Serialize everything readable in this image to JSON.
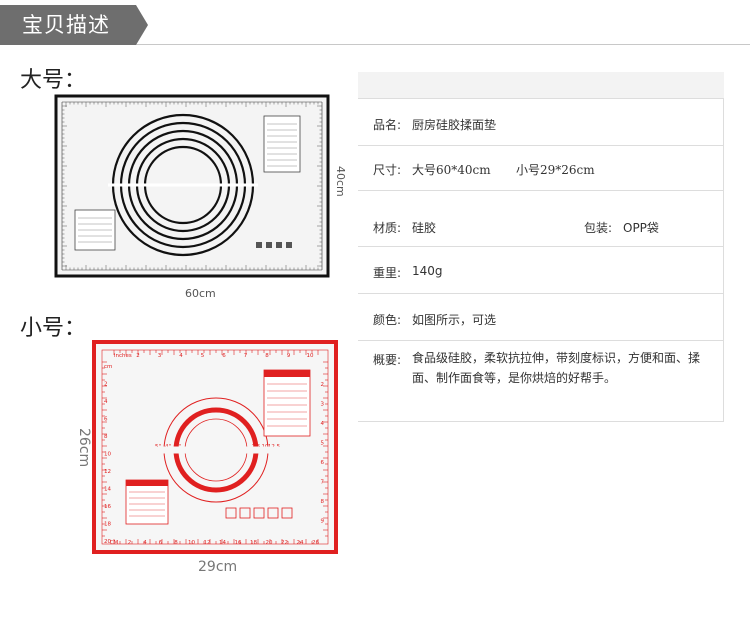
{
  "header": {
    "title": "宝贝描述"
  },
  "sizes": {
    "large_label": "大号：",
    "small_label": "小号："
  },
  "large_mat": {
    "width_label": "60cm",
    "height_label": "40cm"
  },
  "small_mat": {
    "width_label": "29cm",
    "height_label": "26cm",
    "inches_label": "inches",
    "top_ticks": [
      "2",
      "3",
      "4",
      "5",
      "6",
      "7",
      "8",
      "9",
      "10"
    ],
    "bottom_ticks": [
      "CM",
      "2",
      "4",
      "6",
      "8",
      "10",
      "12",
      "14",
      "16",
      "18",
      "20",
      "22",
      "24",
      "26"
    ],
    "left_ticks": [
      "cm",
      "2",
      "4",
      "6",
      "8",
      "10",
      "12",
      "14",
      "16",
      "18",
      "20"
    ],
    "right_ticks": [
      "2",
      "3",
      "4",
      "5",
      "6",
      "7",
      "8",
      "9"
    ],
    "ring_labels_left": [
      "5\"",
      "4\"",
      "3\""
    ],
    "ring_labels_right": [
      "7.5",
      "10",
      "12.5"
    ]
  },
  "specs": {
    "name_label": "品名:",
    "name_value": "厨房硅胶揉面垫",
    "size_label": "尺寸:",
    "size_value_large": "大号60*40cm",
    "size_value_small": "小号29*26cm",
    "material_label": "材质:",
    "material_value": "硅胶",
    "package_label": "包装:",
    "package_value": "OPP袋",
    "weight_label": "重里:",
    "weight_value": "140g",
    "color_label": "颜色:",
    "color_value": "如图所示，可选",
    "summary_label": "概要:",
    "summary_line1": "食品级硅胶，柔软抗拉伸，带刻度标识，方便和面、揉",
    "summary_line2": "面、制作面食等，是你烘焙的好帮手。"
  },
  "colors": {
    "header_tab": "#6e6e6e",
    "mat_red": "#e02020",
    "mat_black": "#111111"
  }
}
